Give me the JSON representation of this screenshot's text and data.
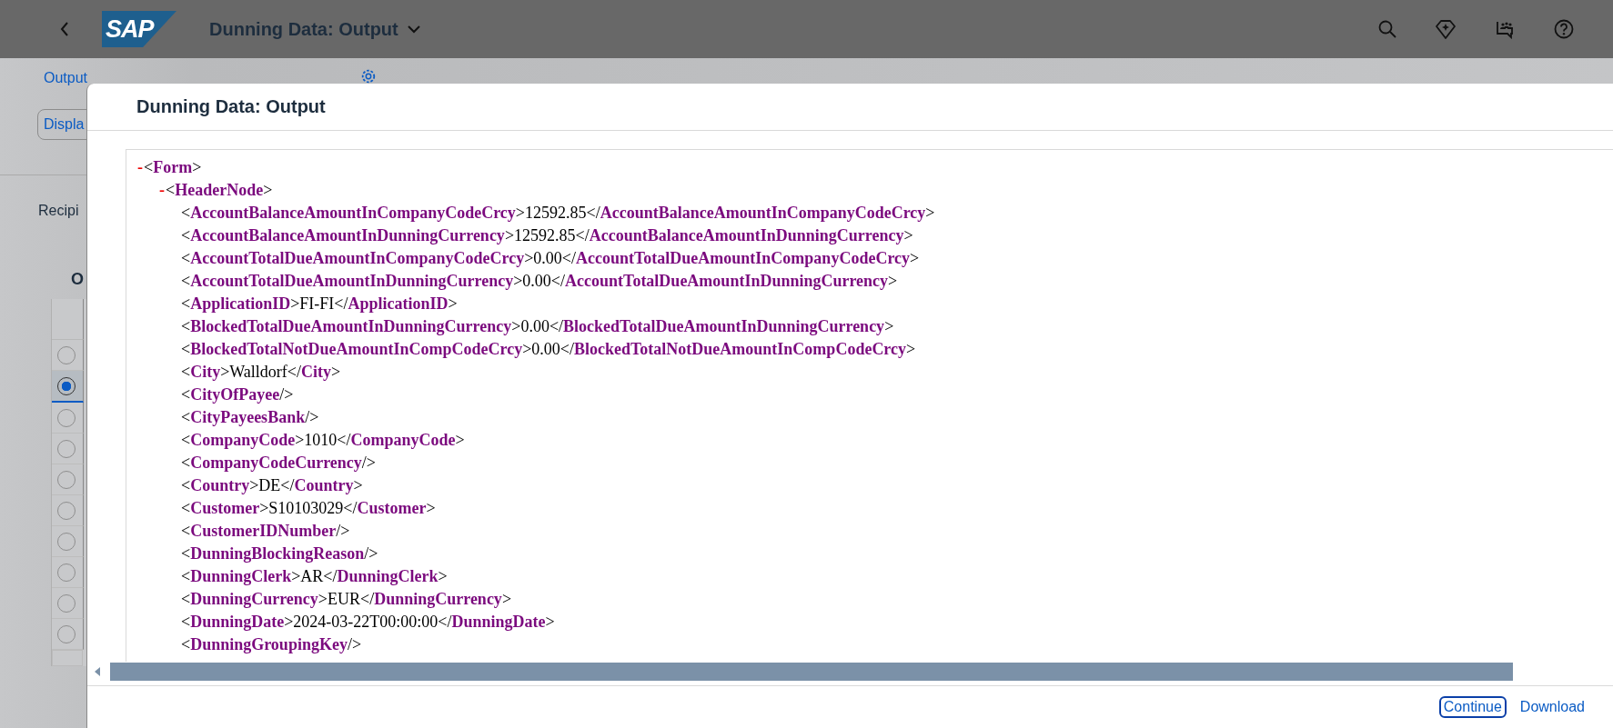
{
  "shell_bar": {
    "logo": "SAP",
    "title": "Dunning Data: Output"
  },
  "background_page": {
    "tabs": [
      {
        "label": "Output",
        "selected": false
      }
    ],
    "display_button": "Displa",
    "recipient_label": "Recipi",
    "table_title": "O",
    "rows": [
      {
        "selected": false
      },
      {
        "selected": true
      },
      {
        "selected": false
      },
      {
        "selected": false
      },
      {
        "selected": false
      },
      {
        "selected": false
      },
      {
        "selected": false
      },
      {
        "selected": false
      },
      {
        "selected": false
      },
      {
        "selected": false
      }
    ]
  },
  "dialog": {
    "title": "Dunning Data: Output",
    "xml": [
      {
        "toggle": "-",
        "text": "<**Form**>",
        "expanded": true,
        "children": [
          {
            "toggle": "-",
            "text": "<**HeaderNode**>",
            "expanded": true,
            "children": [
              {
                "text": "<**AccountBalanceAmountInCompanyCodeCrcy**>12592.85</**AccountBalanceAmountInCompanyCodeCrcy**>"
              },
              {
                "text": "<**AccountBalanceAmountInDunningCurrency**>12592.85</**AccountBalanceAmountInDunningCurrency**>"
              },
              {
                "text": "<**AccountTotalDueAmountInCompanyCodeCrcy**>0.00</**AccountTotalDueAmountInCompanyCodeCrcy**>"
              },
              {
                "text": "<**AccountTotalDueAmountInDunningCurrency**>0.00</**AccountTotalDueAmountInDunningCurrency**>"
              },
              {
                "text": "<**ApplicationID**>FI-FI</**ApplicationID**>"
              },
              {
                "text": "<**BlockedTotalDueAmountInDunningCurrency**>0.00</**BlockedTotalDueAmountInDunningCurrency**>"
              },
              {
                "text": "<**BlockedTotalNotDueAmountInCompCodeCrcy**>0.00</**BlockedTotalNotDueAmountInCompCodeCrcy**>"
              },
              {
                "text": "<**City**>Walldorf</**City**>"
              },
              {
                "text": "<**CityOfPayee**/>"
              },
              {
                "text": "<**CityPayeesBank**/>"
              },
              {
                "text": "<**CompanyCode**>1010</**CompanyCode**>"
              },
              {
                "text": "<**CompanyCodeCurrency**/>"
              },
              {
                "text": "<**Country**>DE</**Country**>"
              },
              {
                "text": "<**Customer**>S10103029</**Customer**>"
              },
              {
                "text": "<**CustomerIDNumber**/>"
              },
              {
                "text": "<**DunningBlockingReason**/>"
              },
              {
                "text": "<**DunningClerk**>AR</**DunningClerk**>"
              },
              {
                "text": "<**DunningCurrency**>EUR</**DunningCurrency**>"
              },
              {
                "text": "<**DunningDate**>2024-03-22T00:00:00</**DunningDate**>"
              },
              {
                "text": "<**DunningGroupingKey**/>"
              }
            ]
          }
        ]
      }
    ],
    "buttons": [
      {
        "label": "Continue",
        "focused": true
      },
      {
        "label": "Download",
        "focused": false
      }
    ]
  }
}
